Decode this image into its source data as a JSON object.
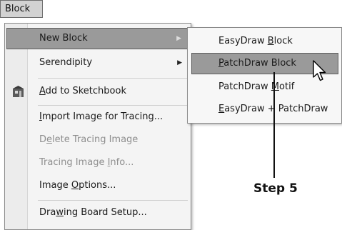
{
  "menubar": {
    "title": "Block"
  },
  "main_menu": {
    "items": [
      {
        "label_a": "New Block",
        "label_b": "",
        "label_c": "",
        "has_submenu": true,
        "highlighted": true
      },
      {
        "label_a": "Serendipity",
        "label_b": "",
        "label_c": "",
        "has_submenu": true
      },
      {
        "label_a": "",
        "label_b": "A",
        "label_c": "dd to Sketchbook",
        "icon": "sketchbook-icon"
      },
      {
        "label_a": "",
        "label_b": "I",
        "label_c": "mport Image for Tracing..."
      },
      {
        "label_a": "D",
        "label_b": "e",
        "label_c": "lete Tracing Image",
        "disabled": true
      },
      {
        "label_a": "Tracing Image ",
        "label_b": "I",
        "label_c": "nfo...",
        "disabled": true
      },
      {
        "label_a": "Image ",
        "label_b": "O",
        "label_c": "ptions..."
      },
      {
        "label_a": "Dra",
        "label_b": "w",
        "label_c": "ing Board Setup..."
      }
    ]
  },
  "submenu_arrow": "▶",
  "sub_menu": {
    "items": [
      {
        "label_a": "EasyDraw ",
        "label_b": "B",
        "label_c": "lock"
      },
      {
        "label_a": "",
        "label_b": "P",
        "label_c": "atchDraw Block",
        "highlighted": true
      },
      {
        "label_a": "PatchDraw ",
        "label_b": "M",
        "label_c": "otif"
      },
      {
        "label_a": "",
        "label_b": "E",
        "label_c": "asyDraw + PatchDraw"
      }
    ]
  },
  "annotation": {
    "text": "Step 5"
  }
}
